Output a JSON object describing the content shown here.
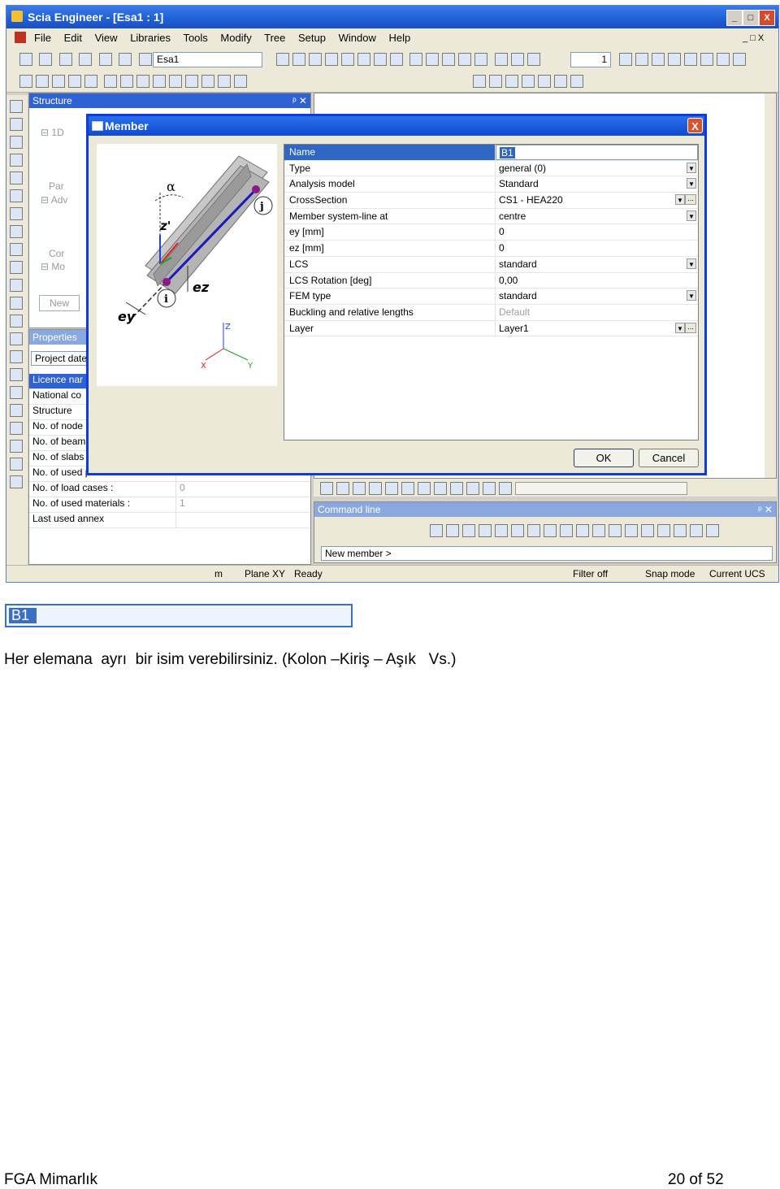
{
  "window": {
    "title": "Scia Engineer - [Esa1 : 1]",
    "controls": [
      "_",
      "□",
      "X"
    ]
  },
  "menu": [
    "File",
    "Edit",
    "View",
    "Libraries",
    "Tools",
    "Modify",
    "Tree",
    "Setup",
    "Window",
    "Help"
  ],
  "toolbar": {
    "project_combo": "Esa1",
    "spin_value": "1"
  },
  "structure_panel": {
    "title": "Structure",
    "tree_items": [
      "1D",
      "Par",
      "Adv",
      "Cor",
      "Mo"
    ],
    "new_button": "New"
  },
  "properties_panel": {
    "title": "Properties",
    "project_row": "Project date",
    "rows": [
      {
        "key": "Licence nar",
        "value": ""
      },
      {
        "key": "National co",
        "value": ""
      },
      {
        "key": "Structure",
        "value": ""
      },
      {
        "key": "No. of node",
        "value": ""
      },
      {
        "key": "No. of beam",
        "value": ""
      },
      {
        "key": "No. of slabs",
        "value": ""
      },
      {
        "key": "No. of used profiles :",
        "value": ""
      },
      {
        "key": "No. of load cases :",
        "value": "0"
      },
      {
        "key": "No. of used materials :",
        "value": "1"
      },
      {
        "key": "Last used annex",
        "value": ""
      }
    ]
  },
  "command_line": {
    "title": "Command line",
    "prompt": "New member >"
  },
  "statusbar": {
    "unit": "m",
    "plane": "Plane XY",
    "state": "Ready",
    "filter": "Filter off",
    "snap": "Snap mode",
    "ucs": "Current UCS"
  },
  "dialog": {
    "title": "Member",
    "close": "X",
    "diagram_labels": {
      "alpha": "α",
      "z_prime": "z'",
      "j": "j",
      "i": "i",
      "ez": "ez",
      "ey": "ey",
      "axis_x": "X",
      "axis_y": "Y",
      "axis_z": "Z"
    },
    "properties": [
      {
        "key": "Name",
        "value": "B1",
        "control": "text",
        "selected": true
      },
      {
        "key": "Type",
        "value": "general (0)",
        "control": "combo"
      },
      {
        "key": "Analysis model",
        "value": "Standard",
        "control": "combo"
      },
      {
        "key": "CrossSection",
        "value": "CS1 - HEA220",
        "control": "combo-dots"
      },
      {
        "key": "Member system-line at",
        "value": "centre",
        "control": "combo"
      },
      {
        "key": "ey [mm]",
        "value": "0",
        "control": "text"
      },
      {
        "key": "ez [mm]",
        "value": "0",
        "control": "text"
      },
      {
        "key": "LCS",
        "value": "standard",
        "control": "combo"
      },
      {
        "key": "LCS Rotation [deg]",
        "value": "0,00",
        "control": "text"
      },
      {
        "key": "FEM type",
        "value": "standard",
        "control": "combo"
      },
      {
        "key": "Buckling and relative lengths",
        "value": "Default",
        "control": "gray"
      },
      {
        "key": "Layer",
        "value": "Layer1",
        "control": "combo-dots"
      }
    ],
    "ok": "OK",
    "cancel": "Cancel"
  },
  "name_field_zoom": "B1",
  "caption": "Her elemana  ayrı  bir isim verebilirsiniz. (Kolon –Kiriş – Aşık   Vs.)",
  "footer": {
    "left": "FGA Mimarlık",
    "right": "20 of  52"
  }
}
